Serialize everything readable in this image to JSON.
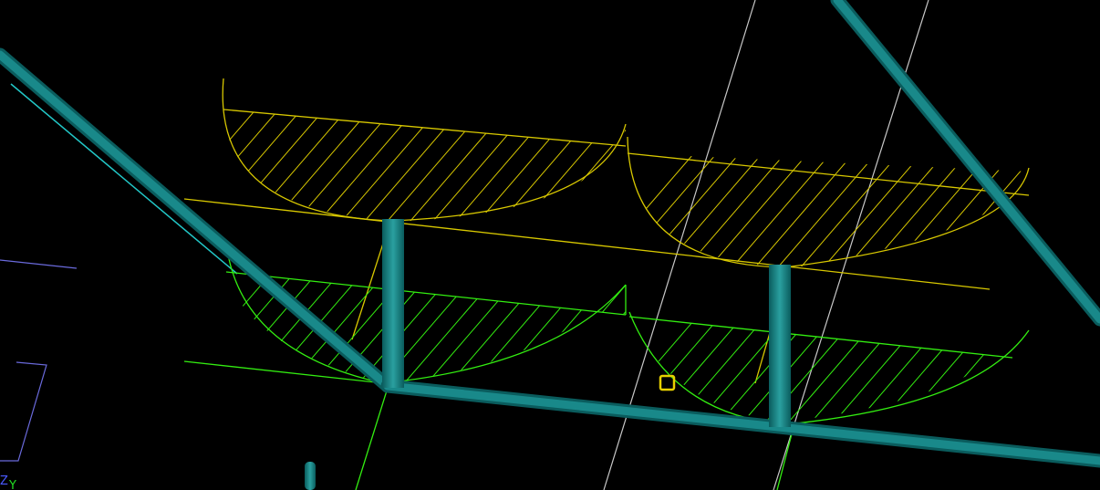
{
  "viewport": {
    "background": "#000000",
    "colors": {
      "upper_level": "#d8c800",
      "lower_level": "#33ee11",
      "beams": "#0e7f80",
      "guide_lines": "#c8c8c8",
      "cyan_line": "#22c8c8",
      "axis_frame": "#6a6adc",
      "snap_marker": "#e6d000"
    },
    "axis_indicator": {
      "z_label": "Z",
      "y_label": "Y",
      "z_color": "#4a5aff",
      "y_color": "#22dd22"
    },
    "snap_marker_icon": "snap-point-square-icon"
  }
}
